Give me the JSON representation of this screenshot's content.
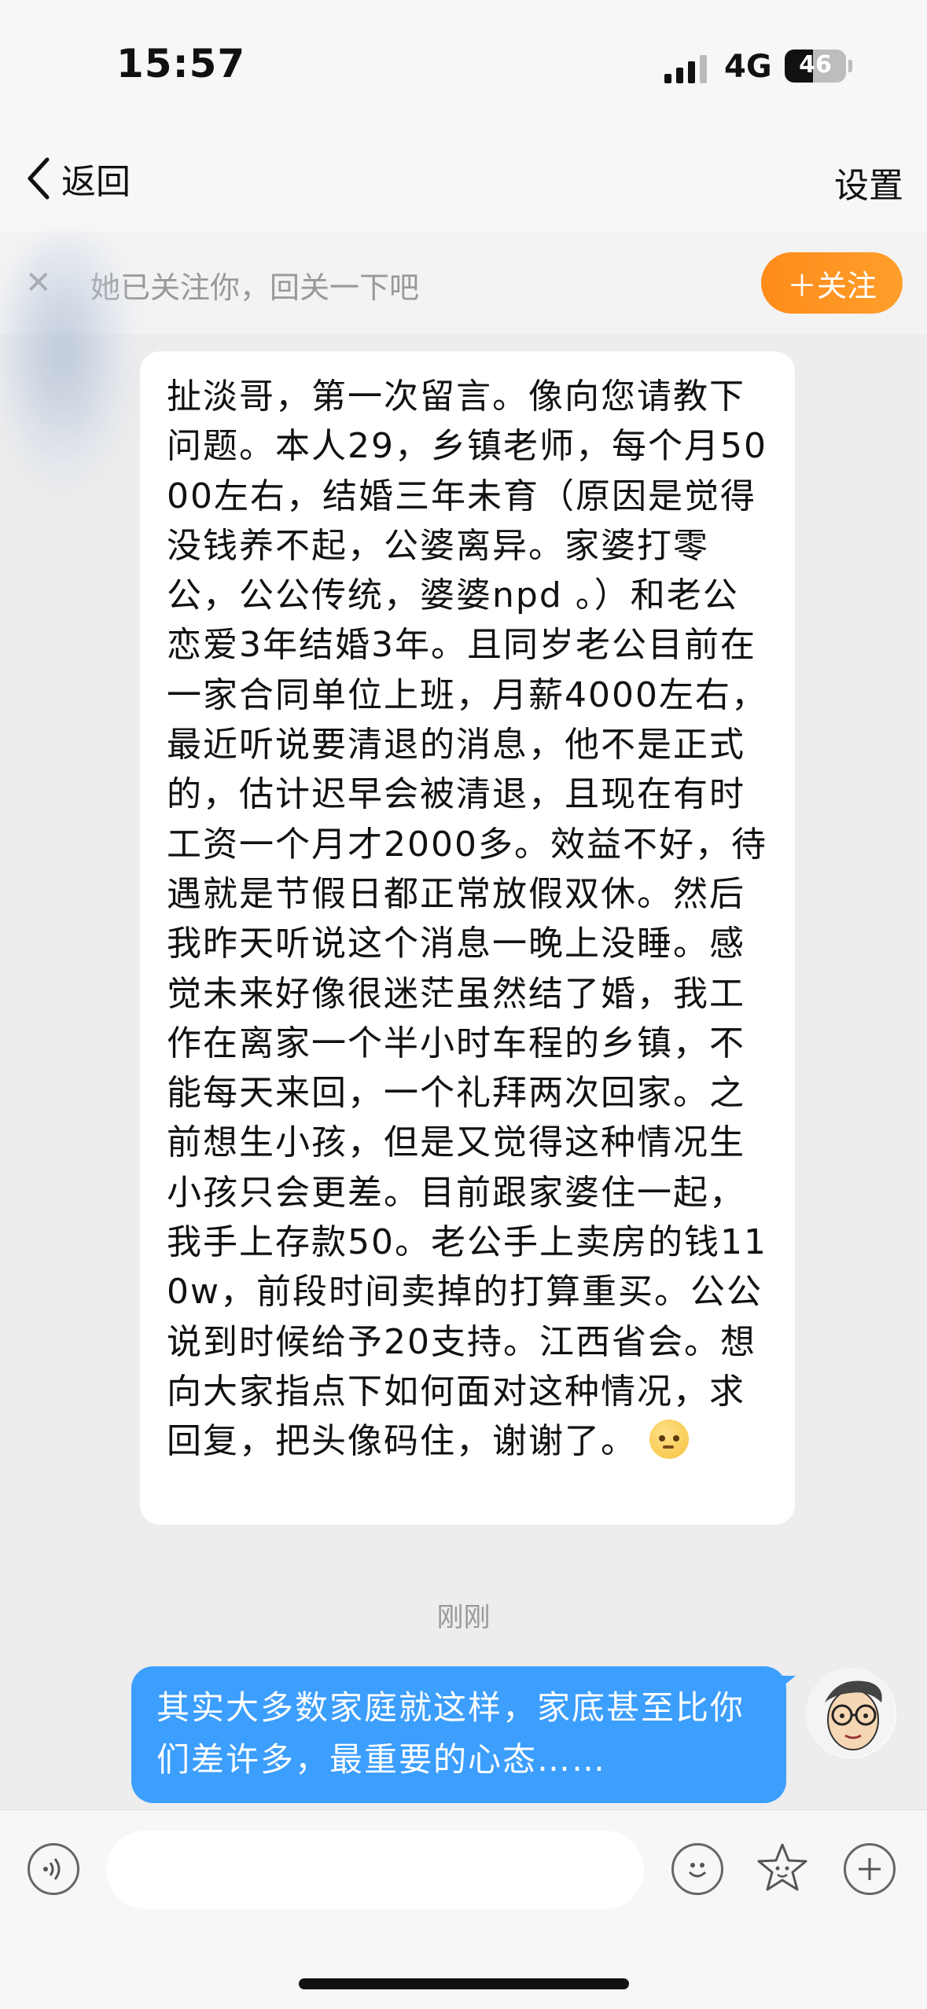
{
  "status_bar": {
    "time": "15:57",
    "network": "4G",
    "battery": "46",
    "battery_level": 0.46
  },
  "nav": {
    "back_label": "返回",
    "settings_label": "设置"
  },
  "follow_banner": {
    "text": "她已关注你，回关一下吧",
    "button_label": "＋关注"
  },
  "messages": {
    "incoming_text": "扯淡哥，第一次留言。像向您请教下问题。本人29，乡镇老师，每个月5000左右，结婚三年未育（原因是觉得没钱养不起，公婆离异。家婆打零公，公公传统，婆婆npd 。）和老公恋爱3年结婚3年。且同岁老公目前在一家合同单位上班，月薪4000左右，最近听说要清退的消息，他不是正式的，估计迟早会被清退，且现在有时工资一个月才2000多。效益不好，待遇就是节假日都正常放假双休。然后我昨天听说这个消息一晚上没睡。感觉未来好像很迷茫虽然结了婚，我工作在离家一个半小时车程的乡镇，不能每天来回，一个礼拜两次回家。之前想生小孩，但是又觉得这种情况生小孩只会更差。目前跟家婆住一起，我手上存款50。老公手上卖房的钱110w，前段时间卖掉的打算重买。公公说到时候给予20支持。江西省会。想向大家指点下如何面对这种情况，求回复，把头像码住，谢谢了。",
    "timestamp": "刚刚",
    "outgoing_text": "其实大多数家庭就这样，家底甚至比你们差许多，最重要的心态……"
  },
  "input_bar": {
    "placeholder": ""
  }
}
